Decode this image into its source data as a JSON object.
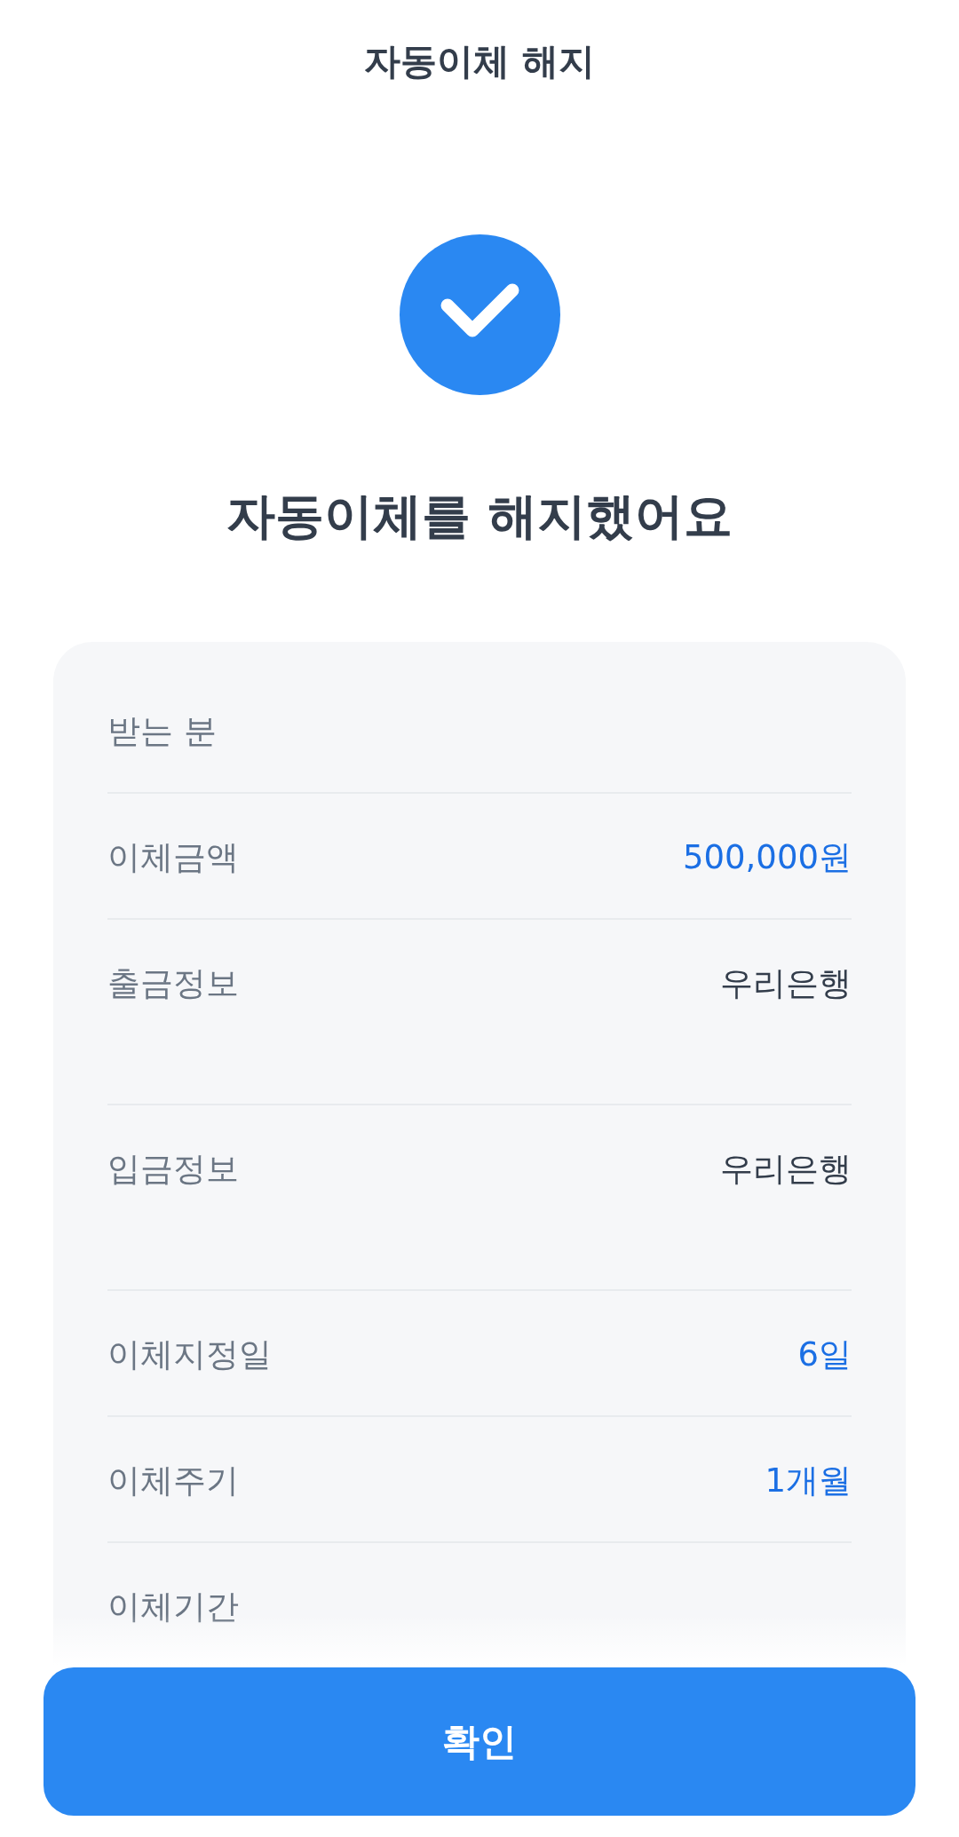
{
  "header": {
    "title": "자동이체 해지"
  },
  "result": {
    "kind": "success",
    "message": "자동이체를 해지했어요"
  },
  "details": [
    {
      "label": "받는 분",
      "kind": "plain"
    },
    {
      "label": "이체금액",
      "value": "500,000원",
      "kind": "highlight"
    },
    {
      "label": "출금정보",
      "value": "우리은행",
      "kind": "bank"
    },
    {
      "label": "입금정보",
      "value": "우리은행",
      "kind": "bank"
    },
    {
      "label": "이체지정일",
      "value": "6일",
      "kind": "highlight"
    },
    {
      "label": "이체주기",
      "value": "1개월",
      "kind": "highlight"
    },
    {
      "label": "이체기간",
      "kind": "plain"
    }
  ],
  "confirm_button": {
    "label": "확인"
  }
}
